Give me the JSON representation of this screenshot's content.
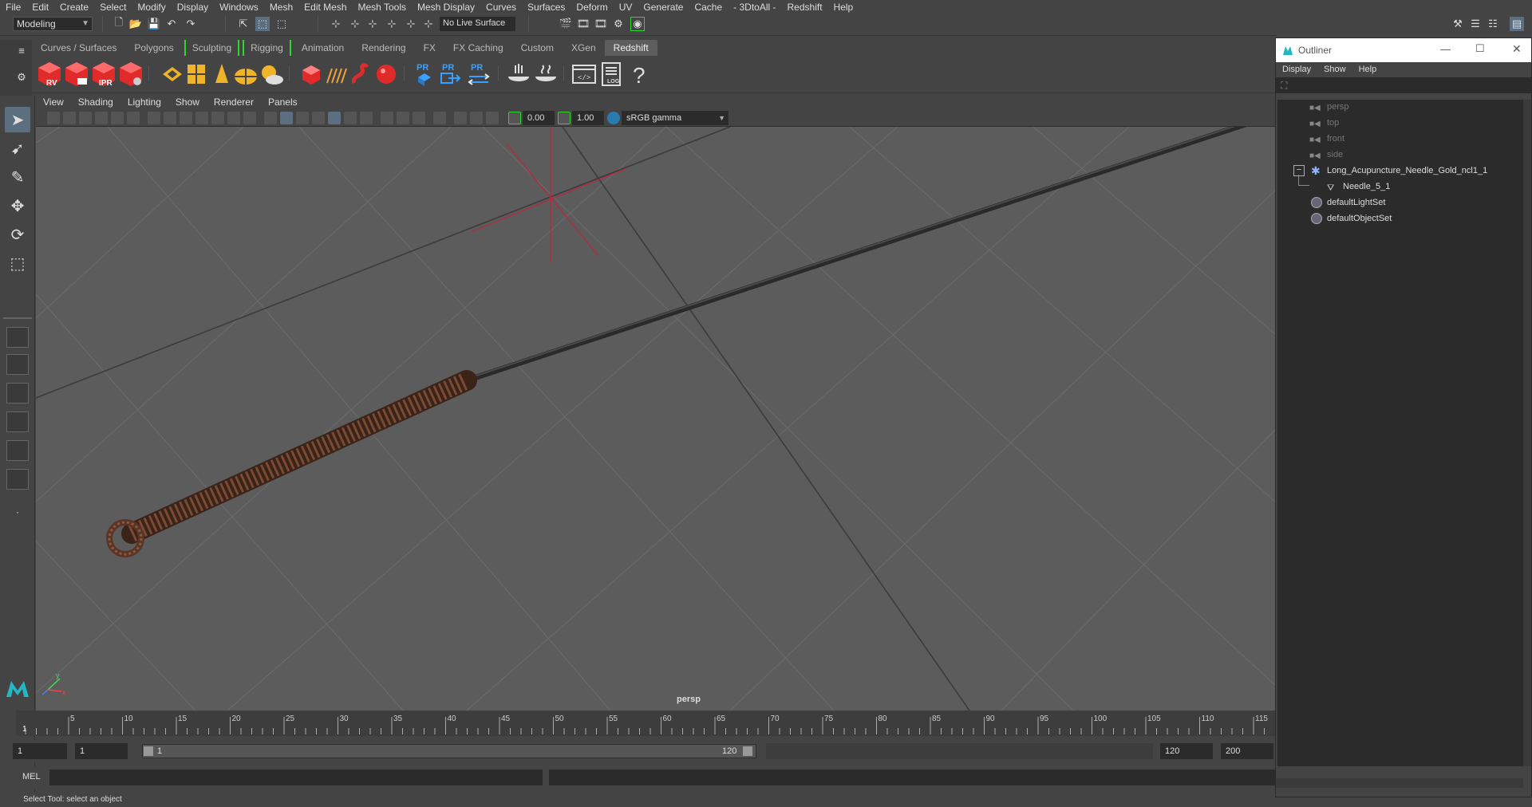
{
  "menubar": [
    "File",
    "Edit",
    "Create",
    "Select",
    "Modify",
    "Display",
    "Windows",
    "Mesh",
    "Edit Mesh",
    "Mesh Tools",
    "Mesh Display",
    "Curves",
    "Surfaces",
    "Deform",
    "UV",
    "Generate",
    "Cache",
    "- 3DtoAll -",
    "Redshift",
    "Help"
  ],
  "status": {
    "mode": "Modeling",
    "live_surface": "No Live Surface"
  },
  "shelf_tabs": [
    "Curves / Surfaces",
    "Polygons",
    "Sculpting",
    "Rigging",
    "Animation",
    "Rendering",
    "FX",
    "FX Caching",
    "Custom",
    "XGen",
    "Redshift"
  ],
  "active_shelf": "Redshift",
  "shelf_icons": {
    "rv": "RV",
    "ipr": "IPR",
    "pr": "PR",
    "log": "LOG",
    "help": "?"
  },
  "panel_menu": [
    "View",
    "Shading",
    "Lighting",
    "Show",
    "Renderer",
    "Panels"
  ],
  "panel_toolbar": {
    "exposure": "0.00",
    "gamma": "1.00",
    "color_space": "sRGB gamma"
  },
  "viewport": {
    "camera_label": "persp",
    "axis_y": "y",
    "axis_x": "x"
  },
  "timeline": {
    "ticks": [
      "5",
      "10",
      "15",
      "20",
      "25",
      "30",
      "35",
      "40",
      "45",
      "50",
      "55",
      "60",
      "65",
      "70",
      "75",
      "80",
      "85",
      "90",
      "95",
      "100",
      "105",
      "110",
      "115"
    ],
    "current_frame": "1"
  },
  "range": {
    "start": "1",
    "anim_start": "1",
    "slider_start": "1",
    "slider_end": "120",
    "end": "120",
    "anim_end": "200"
  },
  "cmdline": {
    "label": "MEL"
  },
  "help_line": "Select Tool: select an object",
  "outliner": {
    "title": "Outliner",
    "menu": [
      "Display",
      "Show",
      "Help"
    ],
    "items": [
      {
        "label": "persp",
        "kind": "camera",
        "dim": true
      },
      {
        "label": "top",
        "kind": "camera",
        "dim": true
      },
      {
        "label": "front",
        "kind": "camera",
        "dim": true
      },
      {
        "label": "side",
        "kind": "camera",
        "dim": true
      },
      {
        "label": "Long_Acupuncture_Needle_Gold_ncl1_1",
        "kind": "group",
        "dim": false
      },
      {
        "label": "Needle_5_1",
        "kind": "mesh",
        "dim": false
      },
      {
        "label": "defaultLightSet",
        "kind": "set",
        "dim": false
      },
      {
        "label": "defaultObjectSet",
        "kind": "set",
        "dim": false
      }
    ]
  },
  "colors": {
    "accent_green": "#2fd62f",
    "selection_blue": "#5b6f80",
    "crosshair_red": "#c0243c"
  }
}
